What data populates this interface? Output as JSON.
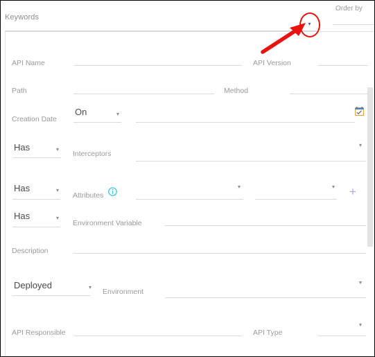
{
  "panel": {
    "keywords_label": "Keywords",
    "keywords_value": "",
    "keywords_caret": "▾",
    "order_by_label": "Order by",
    "order_by_value": ""
  },
  "fields": {
    "api_name": {
      "label": "API Name",
      "value": ""
    },
    "api_version": {
      "label": "API Version",
      "value": ""
    },
    "path": {
      "label": "Path",
      "value": ""
    },
    "method": {
      "label": "Method",
      "value": ""
    },
    "creation_date": {
      "label": "Creation Date",
      "operator": "On",
      "operator_caret": "▾",
      "value": "",
      "calendar_icon": "calendar-icon"
    },
    "interceptors": {
      "label": "Interceptors",
      "operator": "Has",
      "operator_caret": "▾",
      "value": "",
      "value_caret": "▾"
    },
    "attributes": {
      "label": "Attributes",
      "operator": "Has",
      "operator_caret": "▾",
      "info_icon": "info-icon",
      "key_value": "",
      "key_caret": "▾",
      "val_value": "",
      "val_caret": "▾",
      "add_icon": "plus-icon"
    },
    "environment_variable": {
      "label": "Environment Variable",
      "operator": "Has",
      "operator_caret": "▾",
      "value": ""
    },
    "description": {
      "label": "Description",
      "value": ""
    },
    "environment": {
      "label": "Environment",
      "operator": "Deployed",
      "operator_caret": "▾",
      "value": "",
      "value_caret": "▾"
    },
    "api_responsible": {
      "label": "API Responsible",
      "value": ""
    },
    "api_type": {
      "label": "API Type",
      "value": "",
      "value_caret": "▾"
    }
  },
  "annotation": {
    "shape": "ellipse-highlight",
    "pointer": "arrow",
    "color": "#e8120f",
    "target": "keywords-dropdown-caret"
  },
  "colors": {
    "label_grey": "#9a9a9a",
    "value_grey": "#4a4a4a",
    "underline": "#dadada",
    "accent_purple": "#b0a0e8",
    "info_cyan": "#29c5e6",
    "annotation_red": "#e8120f"
  }
}
